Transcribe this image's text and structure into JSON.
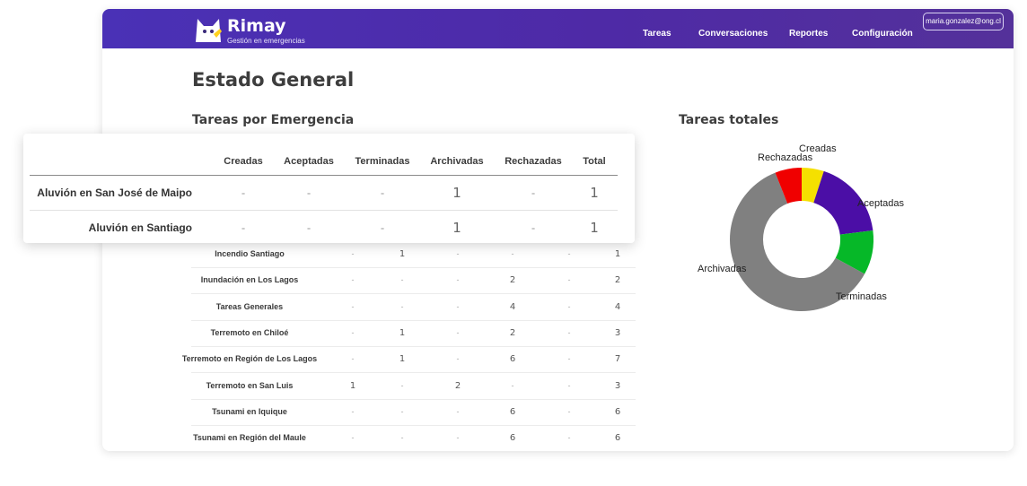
{
  "app": {
    "name": "Rimay",
    "tagline": "Gestión en emergencias",
    "nav": [
      "Tareas",
      "Conversaciones",
      "Reportes",
      "Configuración"
    ],
    "user_email": "maria.gonzalez@ong.cl"
  },
  "page_title": "Estado General",
  "section_left": "Tareas por Emergencia",
  "section_right": "Tareas totales",
  "table": {
    "columns": [
      "Creadas",
      "Aceptadas",
      "Terminadas",
      "Archivadas",
      "Rechazadas",
      "Total"
    ],
    "rows": [
      {
        "name": "Aluvión en San José de Maipo",
        "values": [
          "-",
          "-",
          "-",
          "1",
          "-",
          "1"
        ]
      },
      {
        "name": "Aluvión en Santiago",
        "values": [
          "-",
          "-",
          "-",
          "1",
          "-",
          "1"
        ]
      },
      {
        "name": "Incendio Santiago",
        "values": [
          "-",
          "1",
          "-",
          "-",
          "-",
          "1"
        ]
      },
      {
        "name": "Inundación en Los Lagos",
        "values": [
          "-",
          "-",
          "-",
          "2",
          "-",
          "2"
        ]
      },
      {
        "name": "Tareas Generales",
        "values": [
          "-",
          "-",
          "-",
          "4",
          "-",
          "4"
        ]
      },
      {
        "name": "Terremoto en Chiloé",
        "values": [
          "-",
          "1",
          "-",
          "2",
          "-",
          "3"
        ]
      },
      {
        "name": "Terremoto en Región de Los Lagos",
        "values": [
          "-",
          "1",
          "-",
          "6",
          "-",
          "7"
        ]
      },
      {
        "name": "Terremoto en San Luis",
        "values": [
          "1",
          "-",
          "2",
          "-",
          "-",
          "3"
        ]
      },
      {
        "name": "Tsunami en Iquique",
        "values": [
          "-",
          "-",
          "-",
          "6",
          "-",
          "6"
        ]
      },
      {
        "name": "Tsunami en Región del Maule",
        "values": [
          "-",
          "-",
          "-",
          "6",
          "-",
          "6"
        ]
      }
    ]
  },
  "chart_data": {
    "type": "pie",
    "donut": true,
    "slices": [
      {
        "label": "Creadas",
        "value": 5,
        "color": "#f5e000"
      },
      {
        "label": "Aceptadas",
        "value": 18,
        "color": "#4b0ea6"
      },
      {
        "label": "Terminadas",
        "value": 10,
        "color": "#06b828"
      },
      {
        "label": "Archivadas",
        "value": 61,
        "color": "#808080"
      },
      {
        "label": "Rechazadas",
        "value": 6,
        "color": "#f00000"
      }
    ]
  },
  "colors": {
    "nav_bar": "#4a31b6",
    "accent": "#4b0ea6"
  }
}
